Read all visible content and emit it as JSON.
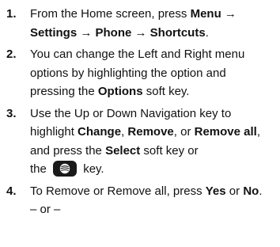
{
  "steps": [
    {
      "number": "1.",
      "lines": [
        [
          {
            "t": "From the Home screen, press "
          },
          {
            "t": "Menu → ",
            "b": true
          }
        ],
        [
          {
            "t": "Settings → Phone → Shortcuts",
            "b": true
          },
          {
            "t": "."
          }
        ]
      ]
    },
    {
      "number": "2.",
      "lines": [
        [
          {
            "t": "You can change the Left and Right menu"
          }
        ],
        [
          {
            "t": "options by highlighting the option and"
          }
        ],
        [
          {
            "t": "pressing the "
          },
          {
            "t": "Options",
            "b": true
          },
          {
            "t": " soft key."
          }
        ]
      ]
    },
    {
      "number": "3.",
      "lines": [
        [
          {
            "t": "Use the Up or Down Navigation key to"
          }
        ],
        [
          {
            "t": "highlight "
          },
          {
            "t": "Change",
            "b": true
          },
          {
            "t": ", "
          },
          {
            "t": "Remove",
            "b": true
          },
          {
            "t": ", or "
          },
          {
            "t": "Remove all",
            "b": true
          },
          {
            "t": ","
          }
        ],
        [
          {
            "t": "and press the "
          },
          {
            "t": "Select",
            "b": true
          },
          {
            "t": " soft key or"
          }
        ],
        [
          {
            "t": "the "
          },
          {
            "icon": "select-key-icon"
          },
          {
            "t": " key."
          }
        ]
      ]
    },
    {
      "number": "4.",
      "lines": [
        [
          {
            "t": "To Remove or Remove all, press "
          },
          {
            "t": "Yes",
            "b": true
          },
          {
            "t": " or "
          },
          {
            "t": "No",
            "b": true
          },
          {
            "t": "."
          }
        ],
        [
          {
            "t": "– or –"
          }
        ]
      ]
    }
  ],
  "colors": {
    "text": "#111111",
    "key_background": "#1a1a1a",
    "key_symbol": "#ffffff"
  }
}
